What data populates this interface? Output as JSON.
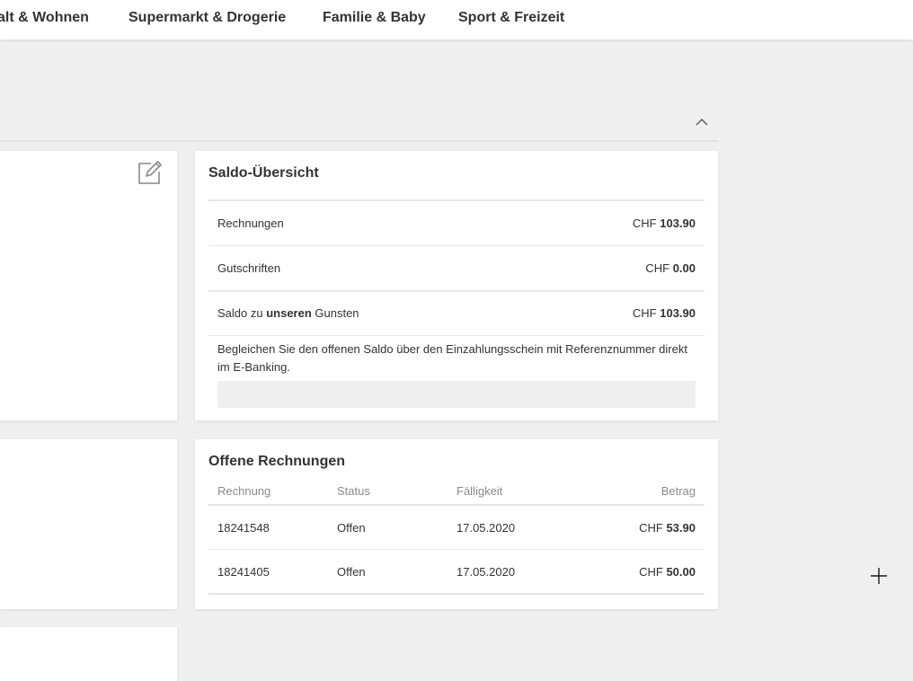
{
  "nav": {
    "items": [
      {
        "label": "alt & Wohnen"
      },
      {
        "label": "Supermarkt & Drogerie"
      },
      {
        "label": "Familie & Baby"
      },
      {
        "label": "Sport & Freizeit"
      }
    ]
  },
  "section": {
    "collapse_icon": "chevron-up-icon"
  },
  "left_card": {
    "edit_icon": "edit-icon"
  },
  "saldo": {
    "title": "Saldo-Übersicht",
    "rows": [
      {
        "label": "Rechnungen",
        "currency": "CHF",
        "amount": "103.90"
      },
      {
        "label": "Gutschriften",
        "currency": "CHF",
        "amount": "0.00"
      },
      {
        "label_pre": "Saldo zu ",
        "label_bold": "unseren",
        "label_post": " Gunsten",
        "currency": "CHF",
        "amount": "103.90"
      }
    ],
    "hint": "Begleichen Sie den offenen Saldo über den Einzahlungsschein mit Referenznummer direkt im E-Banking."
  },
  "invoices": {
    "title": "Offene Rechnungen",
    "columns": [
      "Rechnung",
      "Status",
      "Fälligkeit",
      "Betrag"
    ],
    "rows": [
      {
        "number": "18241548",
        "status": "Offen",
        "due": "17.05.2020",
        "currency": "CHF",
        "amount": "53.90"
      },
      {
        "number": "18241405",
        "status": "Offen",
        "due": "17.05.2020",
        "currency": "CHF",
        "amount": "50.00"
      }
    ]
  },
  "colors": {
    "background": "#efefef",
    "card": "#ffffff",
    "text": "#333333",
    "muted": "#8a8a8a",
    "divider": "#e6e6e6"
  },
  "cursor": {
    "icon": "crosshair-cursor-icon"
  }
}
